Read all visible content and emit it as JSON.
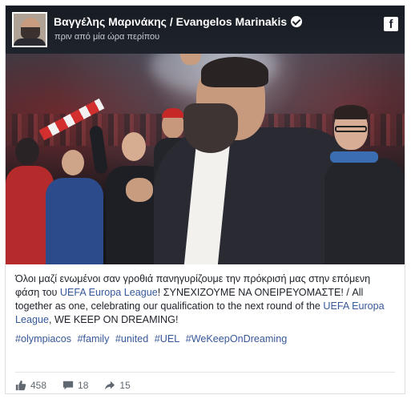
{
  "post": {
    "author": "Βαγγέλης Μαρινάκης / Evangelos Marinakis",
    "time": "πριν από μία ώρα περίπου",
    "caption_greek": "Όλοι μαζί ενωμένοι σαν γροθιά πανηγυρίζουμε την πρόκρισή μας στην επόμενη φάση του ",
    "caption_link1": "UEFA Europa League",
    "caption_mid": "! ΣΥΝΕΧΙΖΟΥΜΕ ΝΑ ΟΝΕΙΡΕΥΟΜΑΣΤΕ! / All together as one, celebrating our qualification to the next round of the ",
    "caption_link2": "UEFA Europa League",
    "caption_end": ", WE KEEP ON DREAMING!",
    "hashtags": [
      "#olympiacos",
      "#family",
      "#united",
      "#UEL",
      "#WeKeepOnDreaming"
    ],
    "reactions": {
      "likes": "458",
      "comments": "18",
      "shares": "15"
    }
  },
  "icons": {
    "verified": "verified-badge-icon",
    "facebook": "facebook-logo-icon",
    "like": "thumbs-up-icon",
    "comment": "comment-icon",
    "share": "share-arrow-icon"
  },
  "colors": {
    "link": "#365899",
    "text": "#1d2129",
    "header_bg": "#1d2129"
  }
}
